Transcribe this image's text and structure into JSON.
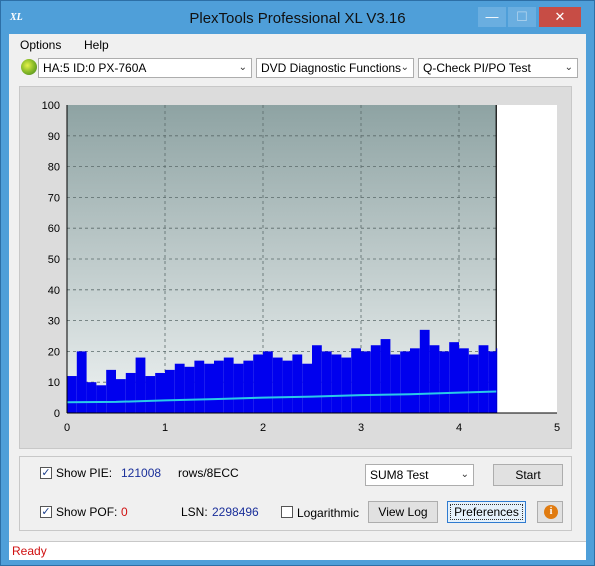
{
  "window": {
    "title": "PlexTools Professional XL V3.16",
    "icon_label": "XL",
    "minimize_glyph": "—",
    "maximize_glyph": "☐",
    "close_glyph": "✕"
  },
  "menu": [
    {
      "label": "Options"
    },
    {
      "label": "Help"
    }
  ],
  "toolbar": {
    "drive": "HA:5 ID:0  PX-760A",
    "function": "DVD Diagnostic Functions",
    "test": "Q-Check PI/PO Test",
    "dropdown_glyph": "⌄"
  },
  "controls": {
    "show_pie_label": "Show PIE:",
    "pie_value": "121008",
    "pie_unit": "rows/8ECC",
    "show_pof_label": "Show POF:",
    "pof_value": "0",
    "lsn_label": "LSN:",
    "lsn_value": "2298496",
    "log_label": "Logarithmic",
    "mode_select": "SUM8 Test",
    "start_button": "Start",
    "view_log_button": "View Log",
    "preferences_button": "Preferences",
    "info_glyph": "i",
    "check_glyph": "✓"
  },
  "status": {
    "text": "Ready",
    "text_color": "#d01010"
  },
  "colors": {
    "pie_bars": "#0000ee",
    "avg_line": "#29c9e8",
    "plot_background_top": "#8ea3a3",
    "plot_background_bottom": "#eef2f2"
  },
  "chart_data": {
    "type": "bar",
    "title": "",
    "xlabel": "",
    "ylabel": "",
    "xlim": [
      0,
      5
    ],
    "ylim": [
      0,
      100
    ],
    "x_ticks": [
      "0",
      "1",
      "2",
      "3",
      "4",
      "5"
    ],
    "y_ticks": [
      "0",
      "10",
      "20",
      "30",
      "40",
      "50",
      "60",
      "70",
      "80",
      "90",
      "100"
    ],
    "grid": true,
    "data_end_x": 4.38,
    "series": [
      {
        "kind": "bar",
        "x": [
          0.0,
          0.1,
          0.2,
          0.3,
          0.4,
          0.5,
          0.6,
          0.7,
          0.8,
          0.9,
          1.0,
          1.1,
          1.2,
          1.3,
          1.4,
          1.5,
          1.6,
          1.7,
          1.8,
          1.9,
          2.0,
          2.1,
          2.2,
          2.3,
          2.4,
          2.5,
          2.6,
          2.7,
          2.8,
          2.9,
          3.0,
          3.1,
          3.2,
          3.3,
          3.4,
          3.5,
          3.6,
          3.7,
          3.8,
          3.9,
          4.0,
          4.1,
          4.2,
          4.3,
          4.38
        ],
        "values": [
          12,
          20,
          10,
          9,
          14,
          11,
          13,
          18,
          12,
          13,
          14,
          16,
          15,
          17,
          16,
          17,
          18,
          16,
          17,
          19,
          20,
          18,
          17,
          19,
          16,
          22,
          20,
          19,
          18,
          21,
          20,
          22,
          24,
          19,
          20,
          21,
          27,
          22,
          20,
          23,
          21,
          19,
          22,
          20,
          21
        ]
      },
      {
        "kind": "line",
        "x": [
          0.0,
          0.5,
          1.0,
          1.5,
          2.0,
          2.5,
          3.0,
          3.5,
          4.0,
          4.38
        ],
        "values": [
          3.5,
          3.6,
          4.1,
          4.5,
          5.0,
          5.3,
          5.8,
          6.1,
          6.6,
          7.0
        ]
      }
    ]
  }
}
